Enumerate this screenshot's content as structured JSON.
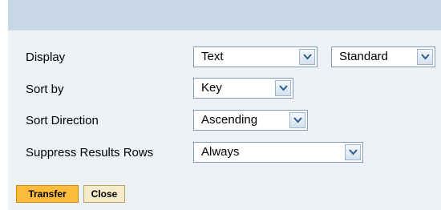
{
  "dialog": {
    "rows": [
      {
        "label": "Display",
        "selects": [
          {
            "value": "Text"
          },
          {
            "value": "Standard"
          }
        ]
      },
      {
        "label": "Sort by",
        "selects": [
          {
            "value": "Key"
          }
        ]
      },
      {
        "label": "Sort Direction",
        "selects": [
          {
            "value": "Ascending"
          }
        ]
      },
      {
        "label": "Suppress Results Rows",
        "selects": [
          {
            "value": "Always"
          }
        ]
      }
    ],
    "buttons": {
      "transfer": "Transfer",
      "close": "Close"
    }
  },
  "colors": {
    "header_bar": "#c8d7e5",
    "panel_background": "#eef2f6",
    "primary_button": "#fcbb3b",
    "secondary_button": "#f6eccc",
    "field_border": "#7f9db9"
  },
  "icons": {
    "dropdown": "chevron-down-icon"
  }
}
